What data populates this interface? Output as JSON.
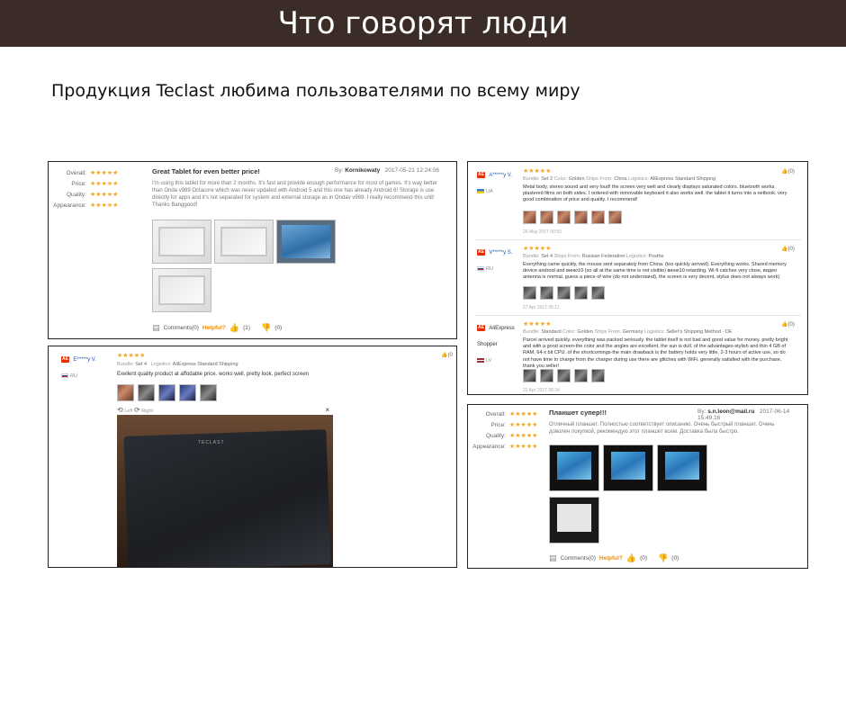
{
  "header": {
    "title": "Что говорят люди"
  },
  "subtitle": "Продукция Teclast любима пользователями по всему миру",
  "review1": {
    "ratings": [
      {
        "label": "Overall:",
        "stars": "★★★★★"
      },
      {
        "label": "Price:",
        "stars": "★★★★★"
      },
      {
        "label": "Quality:",
        "stars": "★★★★★"
      },
      {
        "label": "Appearance:",
        "stars": "★★★★★"
      }
    ],
    "title": "Great Tablet for even better price!",
    "by_label": "By:",
    "author": "Kornikowaty",
    "date": "2017-05-21 12:24:06",
    "body": "I'm using this tablet for more than 2 months. It's fast and provide enough performance for most of games. It's way better than Onda v989 Octacore which was never updated with Android 5 and this one has already Android 6! Storage is use directly for apps and it's not separated for system and external storage as in Ondav v989. I really recommend this unit! Thanks Banggood!",
    "comments_label": "Comments(0)",
    "helpful_label": "Helpful?",
    "up_count": "(1)",
    "down_count": "(0)"
  },
  "review2": {
    "badge": "AE",
    "user": "E*****y V.",
    "country": "RU",
    "stars": "★★★★★",
    "bundle_label": "Bundle:",
    "bundle": "Set 4",
    "logistics_label": "Logistics:",
    "logistics": "AliExpress Standard Shipping",
    "text": "Exellent quality product at affodable price. works well. pretty look. perfect screen",
    "left_label": "Left",
    "right_label": "Right",
    "close": "×",
    "brand_text": "TECLAST",
    "likes": "(0"
  },
  "review3": [
    {
      "badge": "AE",
      "user": "A*****y V.",
      "country": "UA",
      "flag": "ua",
      "stars": "★★★★★",
      "meta": [
        {
          "k": "Bundle:",
          "v": "Set 2"
        },
        {
          "k": "Color:",
          "v": "Golden"
        },
        {
          "k": "Ships From:",
          "v": "China"
        },
        {
          "k": "Logistics:",
          "v": "AliExpress Standard Shipping"
        }
      ],
      "text": "Metal body, stereo sound and very loud! the screen very well and clearly displays saturated colors. bluetooth works. plastered films on both sides. I ordered with removable keyboard it also works well. the tablet it turns into a netbook. very good combination of price and quality. I recommend!",
      "date": "26 May 2017 00:50",
      "likes": "(0)"
    },
    {
      "badge": "AE",
      "user": "V*****y S.",
      "country": "RU",
      "flag": "ru",
      "stars": "★★★★★",
      "meta": [
        {
          "k": "Bundle:",
          "v": "Set 4"
        },
        {
          "k": "Ships From:",
          "v": "Russian Federation"
        },
        {
          "k": "Logistics:",
          "v": "Posthe"
        }
      ],
      "text": "Everything came quickly, the mouse sent separately from China. (too quickly arrived). Everything works. Shared memory device android and виню10 (so all at the same time is not visible) виню10 retarding. Wi-fi catches very close, видео antenna is normal, guess a piece of wire (do not understand), the screen is very decent, stylus does not always work)",
      "date": "27 Apr 2017 05:11",
      "likes": "(0)"
    },
    {
      "badge": "AE",
      "user": "AliExpress Shopper",
      "country": "LV",
      "flag": "lv",
      "stars": "★★★★★",
      "meta": [
        {
          "k": "Bundle:",
          "v": "Standard"
        },
        {
          "k": "Color:",
          "v": "Golden"
        },
        {
          "k": "Ships From:",
          "v": "Germany"
        },
        {
          "k": "Logistics:",
          "v": "Seller's Shipping Method - DE"
        }
      ],
      "text": "Parcel arrived quickly, everything was packed seriously. the tablet itself is not bad and good value for money. pretty bright and with a good screen-the color and the angles are excellent, the sun is dull. of the advantages-stylish and thin 4 GB of RAM, 64-x bit CPU. of the shortcomings-the main drawback is the battery holds very little, 2-3 hours of active use, so do not have time to charge from the charger during use there are glitches with WiFi. generally satisfied with the purchase, thank you seller!",
      "date": "22 Apr 2017 06:34",
      "likes": "(0)"
    }
  ],
  "review4": {
    "ratings": [
      {
        "label": "Overall:",
        "stars": "★★★★★"
      },
      {
        "label": "Price:",
        "stars": "★★★★★"
      },
      {
        "label": "Quality:",
        "stars": "★★★★★"
      },
      {
        "label": "Appearance:",
        "stars": "★★★★★"
      }
    ],
    "title": "Планшет супер!!!",
    "by_label": "By:",
    "author": "s.n.leon@mail.ru",
    "date": "2017-06-14 15:49:16",
    "body": "Отличный планшет. Полностью соответствует описанию. Очень быстрый планшет. Очень доволен покупкой, рекомендую этот планшет всем. Доставка была быстро.",
    "comments_label": "Comments(0)",
    "helpful_label": "Helpful?",
    "up_count": "(0)",
    "down_count": "(0)"
  },
  "colors": {
    "banner": "#3b2c27",
    "star": "#f5a623",
    "helpful": "#f08a00",
    "ae_badge": "#e62e04"
  }
}
